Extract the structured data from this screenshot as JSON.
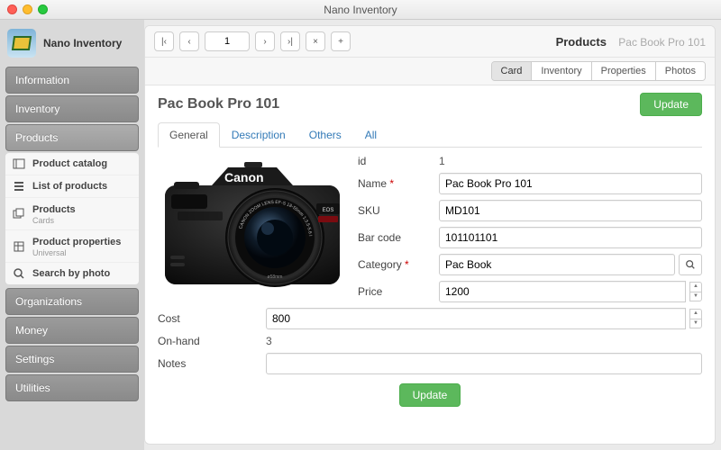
{
  "window": {
    "title": "Nano Inventory"
  },
  "brand": {
    "name": "Nano Inventory"
  },
  "sidebar": {
    "items": [
      {
        "label": "Information"
      },
      {
        "label": "Inventory"
      },
      {
        "label": "Products",
        "active": true
      },
      {
        "label": "Organizations"
      },
      {
        "label": "Money"
      },
      {
        "label": "Settings"
      },
      {
        "label": "Utilities"
      }
    ],
    "sub": [
      {
        "label": "Product catalog",
        "icon": "catalog"
      },
      {
        "label": "List of products",
        "icon": "list"
      },
      {
        "label": "Products",
        "meta": "Cards",
        "icon": "cards"
      },
      {
        "label": "Product properties",
        "meta": "Universal",
        "icon": "props"
      },
      {
        "label": "Search by photo",
        "icon": "search"
      }
    ]
  },
  "pager": {
    "page": "1"
  },
  "breadcrumb": {
    "section": "Products",
    "item": "Pac Book Pro 101"
  },
  "viewTabs": [
    "Card",
    "Inventory",
    "Properties",
    "Photos"
  ],
  "viewTabActive": 0,
  "heading": "Pac Book Pro 101",
  "updateLabel": "Update",
  "tabs": [
    "General",
    "Description",
    "Others",
    "All"
  ],
  "tabActive": 0,
  "product": {
    "brandOnImage": "Canon",
    "lensText": "CANON ZOOM LENS EF-S 18-55mm 1:3.5-5.6 IS"
  },
  "fields": {
    "id": {
      "label": "id",
      "value": "1"
    },
    "name": {
      "label": "Name",
      "value": "Pac Book Pro 101",
      "required": true
    },
    "sku": {
      "label": "SKU",
      "value": "MD101"
    },
    "barcode": {
      "label": "Bar code",
      "value": "101101101"
    },
    "category": {
      "label": "Category",
      "value": "Pac Book",
      "required": true
    },
    "price": {
      "label": "Price",
      "value": "1200"
    },
    "cost": {
      "label": "Cost",
      "value": "800"
    },
    "onhand": {
      "label": "On-hand",
      "value": "3"
    },
    "notes": {
      "label": "Notes",
      "value": ""
    }
  }
}
